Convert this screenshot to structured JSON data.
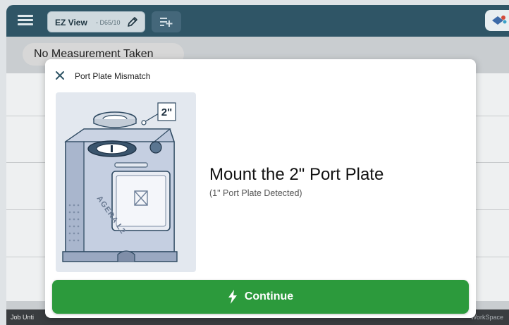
{
  "header": {
    "tab_label": "EZ View",
    "tab_sub": "- D65/10",
    "icons": [
      "menu-icon",
      "pencil-icon",
      "playlist-add-icon",
      "paint-icon"
    ]
  },
  "main": {
    "measurement_status": "No Measurement Taken"
  },
  "statusbar": {
    "job": "Job  Unti",
    "workspace": "WorkSpace"
  },
  "dialog": {
    "title": "Port Plate Mismatch",
    "headline": "Mount the 2\" Port Plate",
    "subtext": "(1\" Port Plate Detected)",
    "plate_size_badge": "2\"",
    "device_label": "AGERA L2",
    "continue_label": "Continue",
    "colors": {
      "accent": "#2c9a3c",
      "header": "#2f5566"
    }
  }
}
